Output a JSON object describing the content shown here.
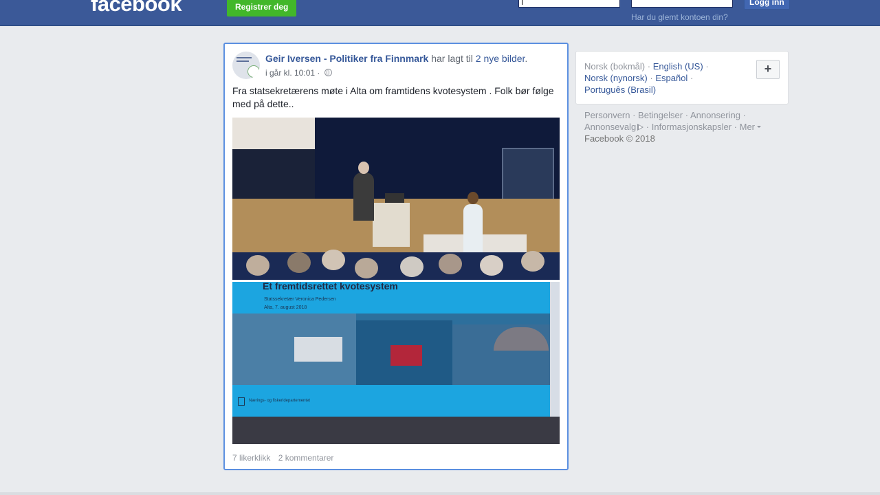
{
  "topbar": {
    "logo": "facebook",
    "signup_label": "Registrer deg",
    "login_label": "Logg inn",
    "forgot_label": "Har du glemt kontoen din?",
    "email_value": "",
    "password_value": ""
  },
  "post": {
    "author": "Geir Iversen - Politiker fra Finnmark",
    "action": "har lagt til",
    "photos_link": "2 nye bilder",
    "period": ".",
    "timestamp": "i går kl. 10:01",
    "separator": "·",
    "text": "Fra statsekretærens møte i Alta om framtidens kvotesystem . Folk bør følge med på dette..",
    "photo2_title": "Et fremtidsrettet kvotesystem",
    "photo2_subtitle": "Statssekretær Veronica Pedersen",
    "photo2_date": "Alta, 7. august 2018",
    "photo2_caption": "Nærings- og fiskeridepartementet",
    "likes": "7 likerklikk",
    "comments": "2 kommentarer"
  },
  "languages": {
    "current": "Norsk (bokmål)",
    "items": [
      "English (US)",
      "Norsk (nynorsk)",
      "Español",
      "Português (Brasil)"
    ],
    "sep": "·",
    "plus_label": "+"
  },
  "footer": {
    "links": [
      "Personvern",
      "Betingelser",
      "Annonsering",
      "Annonsevalg",
      "Informasjonskapsler",
      "Mer"
    ],
    "copyright": "Facebook © 2018"
  },
  "colors": {
    "brand": "#3b5998",
    "link": "#365899",
    "signup": "#42b72a",
    "post_highlight": "#5b8fe0"
  }
}
